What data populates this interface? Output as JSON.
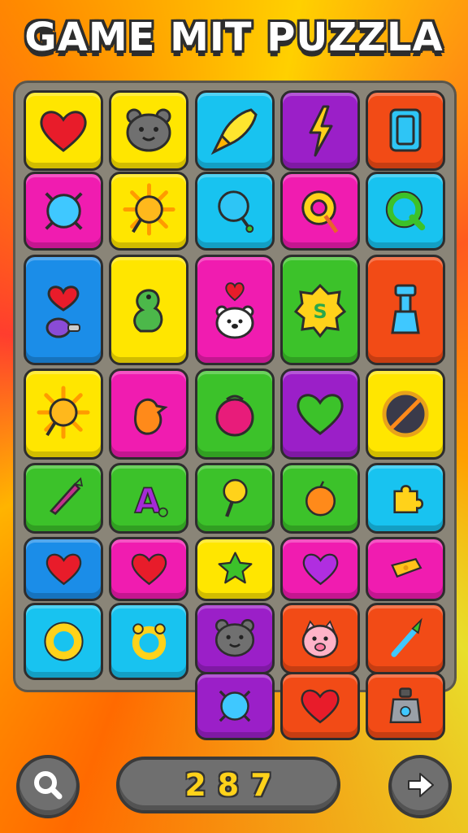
{
  "title": "GAME MIT PUZZLA",
  "score": "287",
  "colors": {
    "yellow": "#ffe600",
    "cyan": "#18c3f0",
    "purple": "#9b1fc8",
    "red": "#f24b16",
    "magenta": "#f01cb0",
    "blue": "#1b8de8",
    "green": "#3cc22a"
  },
  "buttons": {
    "left": "search-icon",
    "right": "arrow-right-icon"
  },
  "tiles": [
    {
      "color": "yellow",
      "icon": "heart-icon"
    },
    {
      "color": "yellow",
      "icon": "bear-face-icon"
    },
    {
      "color": "cyan",
      "icon": "rocket-icon"
    },
    {
      "color": "purple",
      "icon": "lightning-icon"
    },
    {
      "color": "red",
      "icon": "card-icon"
    },
    {
      "color": "magenta",
      "icon": "blue-ball-icon"
    },
    {
      "color": "yellow",
      "icon": "sun-icon"
    },
    {
      "color": "cyan",
      "icon": "balloon-icon"
    },
    {
      "color": "magenta",
      "icon": "lollipop-icon"
    },
    {
      "color": "cyan",
      "icon": "letter-q-icon"
    },
    {
      "color": "blue",
      "icon": "heart-mushroom-icon"
    },
    {
      "color": "yellow",
      "icon": "dinosaur-icon"
    },
    {
      "color": "magenta",
      "icon": "heart-bear-icon"
    },
    {
      "color": "green",
      "icon": "s-badge-icon"
    },
    {
      "color": "red",
      "icon": "bottle-icon"
    },
    {
      "color": "yellow",
      "icon": "sun-icon"
    },
    {
      "color": "magenta",
      "icon": "duck-icon"
    },
    {
      "color": "green",
      "icon": "berry-icon"
    },
    {
      "color": "purple",
      "icon": "heart-icon"
    },
    {
      "color": "yellow",
      "icon": "compass-icon"
    },
    {
      "color": "green",
      "icon": "carrot-icon"
    },
    {
      "color": "green",
      "icon": "letter-a-icon"
    },
    {
      "color": "green",
      "icon": "pin-icon"
    },
    {
      "color": "green",
      "icon": "orange-fruit-icon"
    },
    {
      "color": "cyan",
      "icon": "puzzle-piece-icon"
    },
    {
      "color": "blue",
      "icon": "heart-icon"
    },
    {
      "color": "magenta",
      "icon": "heart-icon"
    },
    {
      "color": "yellow",
      "icon": "star-blob-icon"
    },
    {
      "color": "magenta",
      "icon": "heart-icon"
    },
    {
      "color": "magenta",
      "icon": "cheese-icon"
    },
    {
      "color": "cyan",
      "icon": "ring-icon"
    },
    {
      "color": "cyan",
      "icon": "flower-ring-icon"
    },
    {
      "color": "purple",
      "icon": "bear-face-icon"
    },
    {
      "color": "red",
      "icon": "pig-face-icon"
    },
    {
      "color": "red",
      "icon": "brush-icon"
    },
    {
      "color": "purple",
      "icon": "blue-ball-icon"
    },
    {
      "color": "red",
      "icon": "heart-icon"
    },
    {
      "color": "red",
      "icon": "weight-icon"
    }
  ]
}
